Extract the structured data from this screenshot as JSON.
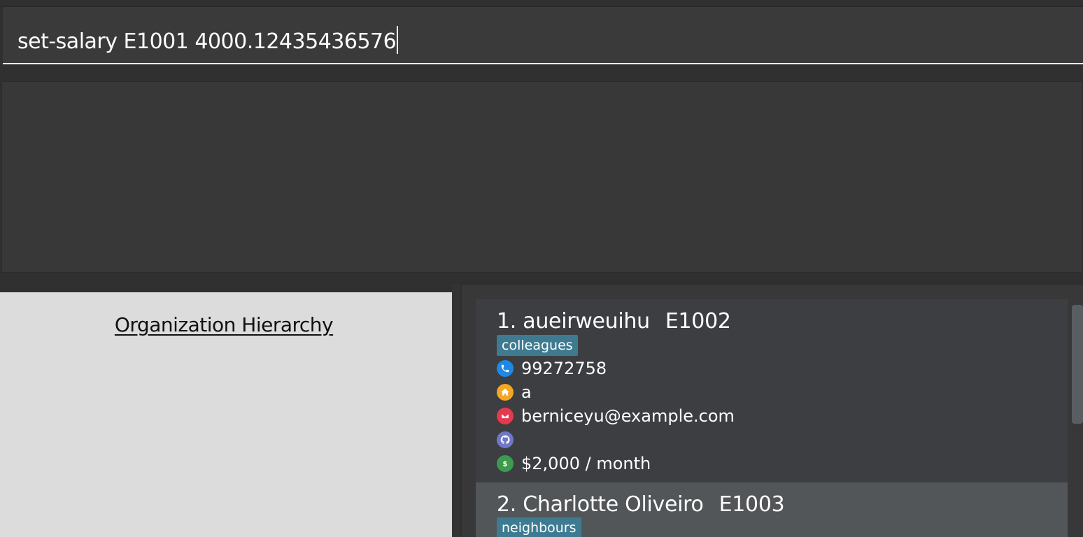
{
  "command_box": {
    "value": "set-salary E1001 4000.12435436576"
  },
  "result_display": {
    "text": ""
  },
  "hierarchy_panel": {
    "title": "Organization Hierarchy"
  },
  "person_list": {
    "persons": [
      {
        "index_name": "1. aueirweuihu",
        "employee_id": "E1002",
        "tag": "colleagues",
        "phone": "99272758",
        "address": "a",
        "email": "berniceyu@example.com",
        "github": "",
        "salary": "$2,000 / month"
      },
      {
        "index_name": "2. Charlotte Oliveiro",
        "employee_id": "E1003",
        "tag": "neighbours"
      }
    ]
  },
  "icons": {
    "phone": "phone-icon",
    "address": "home-icon",
    "email": "mail-icon",
    "github": "github-icon",
    "salary": "dollar-icon"
  },
  "colors": {
    "background": "#333333",
    "tag": "#3e7b91",
    "phone_icon": "#1e88e5",
    "home_icon": "#f5a623",
    "mail_icon": "#e53950",
    "github_icon": "#6f77c8",
    "salary_icon": "#3e9b4d",
    "selected_card": "#525659"
  }
}
